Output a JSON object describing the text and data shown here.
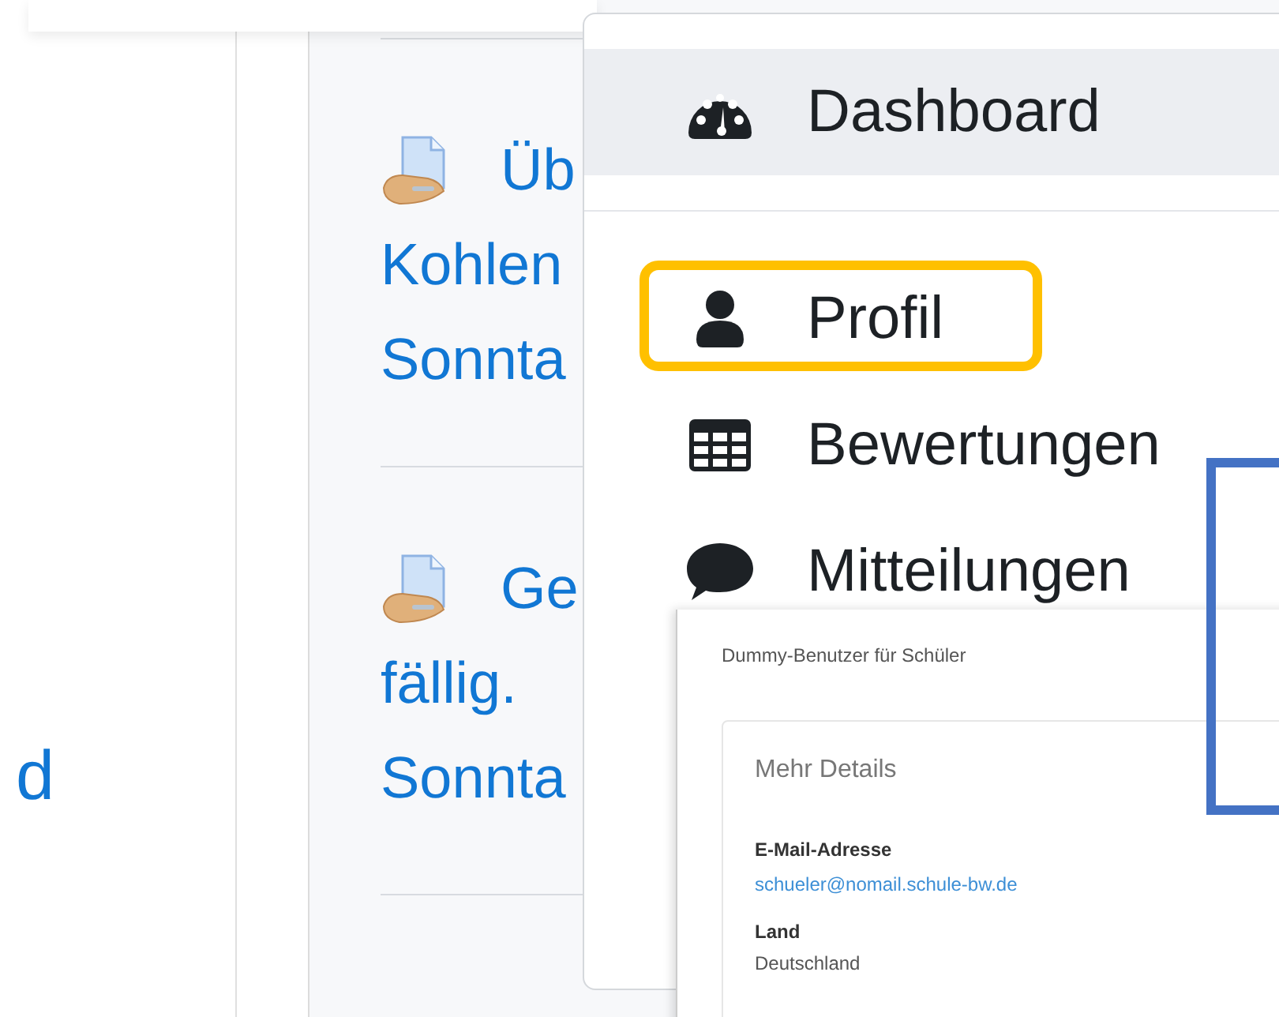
{
  "left_column": {
    "link_fragment": "d"
  },
  "activities": [
    {
      "lines": [
        "Üb",
        "Kohlen",
        "Sonnta"
      ]
    },
    {
      "lines": [
        "Ge",
        "fällig.",
        "Sonnta"
      ]
    }
  ],
  "user_menu": {
    "sections": [
      [
        {
          "kind": "gauge",
          "label": "Dashboard",
          "hovered": true
        }
      ],
      [
        {
          "kind": "user",
          "label": "Profil",
          "hovered": false
        },
        {
          "kind": "table",
          "label": "Bewertungen",
          "hovered": false
        },
        {
          "kind": "bubble",
          "label": "Mitteilungen",
          "hovered": false
        }
      ]
    ]
  },
  "profile_card": {
    "name": "Dummy-Benutzer für Schüler",
    "section_title": "Mehr Details",
    "fields": [
      {
        "label": "E-Mail-Adresse",
        "value": "schueler@nomail.schule-bw.de",
        "kind": "link"
      },
      {
        "label": "Land",
        "value": "Deutschland",
        "kind": "text"
      }
    ]
  },
  "annotation_frames": [
    {
      "color": "#ffc000"
    },
    {
      "color": "#4472c4"
    }
  ]
}
